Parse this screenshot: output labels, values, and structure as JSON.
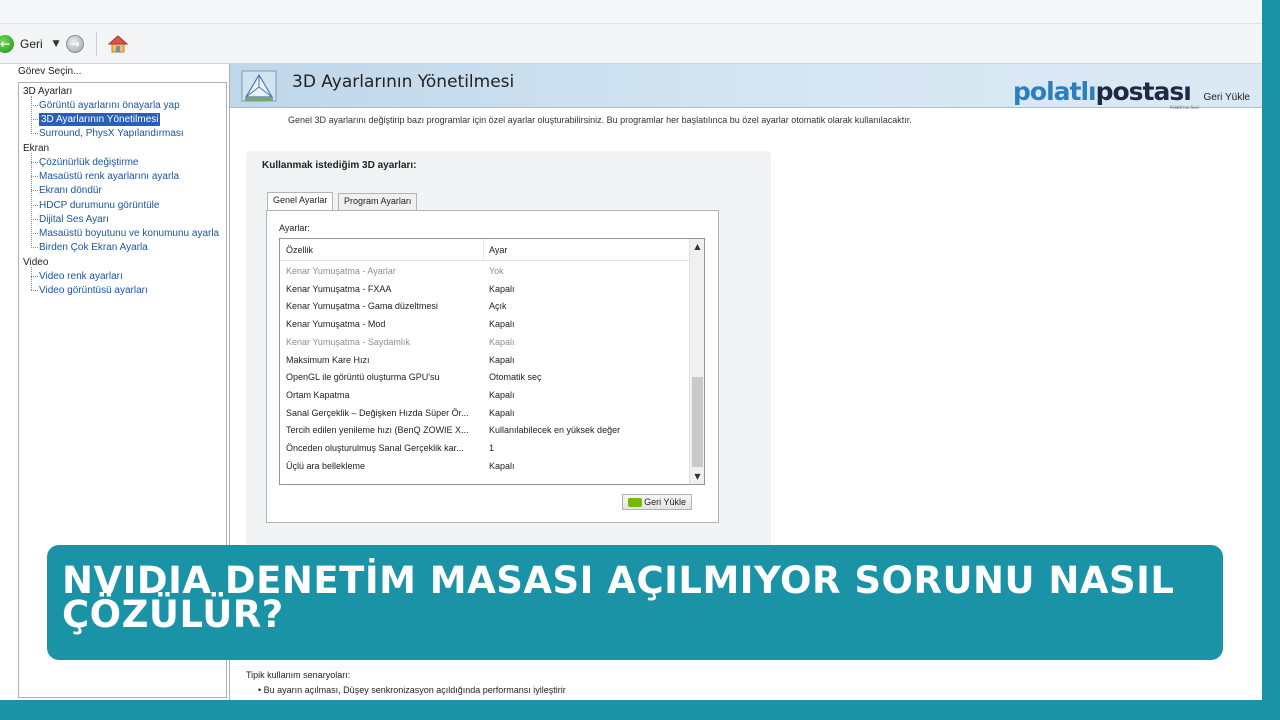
{
  "toolbar": {
    "back_label": "Geri",
    "back_icon": "back-arrow-icon",
    "forward_icon": "forward-arrow-icon",
    "home_icon": "home-icon"
  },
  "sidebar": {
    "header": "Görev Seçin...",
    "items": [
      {
        "type": "category",
        "label": "3D Ayarları"
      },
      {
        "type": "leaf",
        "label": "Görüntü ayarlarını önayarla yap"
      },
      {
        "type": "leaf",
        "label": "3D Ayarlarının Yönetilmesi",
        "selected": true
      },
      {
        "type": "leaf",
        "label": "Surround, PhysX Yapılandırması"
      },
      {
        "type": "category",
        "label": "Ekran"
      },
      {
        "type": "leaf",
        "label": "Çözünürlük değiştirme"
      },
      {
        "type": "leaf",
        "label": "Masaüstü renk ayarlarını ayarla"
      },
      {
        "type": "leaf",
        "label": "Ekranı döndür"
      },
      {
        "type": "leaf",
        "label": "HDCP durumunu görüntüle"
      },
      {
        "type": "leaf",
        "label": "Dijital Ses Ayarı"
      },
      {
        "type": "leaf",
        "label": "Masaüstü boyutunu ve konumunu ayarla"
      },
      {
        "type": "leaf",
        "label": "Birden Çok Ekran Ayarla"
      },
      {
        "type": "category",
        "label": "Video"
      },
      {
        "type": "leaf",
        "label": "Video renk ayarları"
      },
      {
        "type": "leaf",
        "label": "Video görüntüsü ayarları"
      }
    ]
  },
  "main": {
    "title": "3D Ayarlarının Yönetilmesi",
    "restore_link": "Geri Yükle",
    "description": "Genel 3D ayarlarını değiştirip bazı programlar için özel ayarlar oluşturabilirsiniz. Bu programlar her başlatılınca bu özel ayarlar otomatik olarak kullanılacaktır.",
    "group_label": "Kullanmak istediğim 3D ayarları:",
    "tabs": [
      "Genel Ayarlar",
      "Program Ayarları"
    ],
    "settings_label": "Ayarlar:",
    "columns": [
      "Özellik",
      "Ayar"
    ],
    "rows": [
      {
        "feature": "Kenar Yumuşatma - Ayarlar",
        "value": "Yok",
        "disabled": true
      },
      {
        "feature": "Kenar Yumuşatma - FXAA",
        "value": "Kapalı",
        "disabled": false
      },
      {
        "feature": "Kenar Yumuşatma - Gama düzeltmesi",
        "value": "Açık",
        "disabled": false
      },
      {
        "feature": "Kenar Yumuşatma - Mod",
        "value": "Kapalı",
        "disabled": false
      },
      {
        "feature": "Kenar Yumuşatma - Saydamlık",
        "value": "Kapalı",
        "disabled": true
      },
      {
        "feature": "Maksimum Kare Hızı",
        "value": "Kapalı",
        "disabled": false
      },
      {
        "feature": "OpenGL ile görüntü oluşturma GPU'su",
        "value": "Otomatik seç",
        "disabled": false
      },
      {
        "feature": "Ortam Kapatma",
        "value": "Kapalı",
        "disabled": false
      },
      {
        "feature": "Sanal Gerçeklik – Değişken Hızda Süper Ör...",
        "value": "Kapalı",
        "disabled": false
      },
      {
        "feature": "Tercih edilen yenileme hızı (BenQ ZOWIE X...",
        "value": "Kullanılabilecek en yüksek değer",
        "disabled": false
      },
      {
        "feature": "Önceden oluşturulmuş Sanal Gerçeklik kar...",
        "value": "1",
        "disabled": false
      },
      {
        "feature": "Üçlü ara bellekleme",
        "value": "Kapalı",
        "disabled": false
      }
    ],
    "restore_button": "Geri Yükle",
    "usage_heading": "Tipik kullanım senaryoları:",
    "usage_item": "• Bu ayarın açılması, Düşey senkronizasyon açıldığında performansı iyileştirir"
  },
  "logo": {
    "part1": "polatlı",
    "part2": "postası",
    "sub": "Polatlı'nın Sesi"
  },
  "headline": "NVIDIA DENETİM MASASI AÇILMIYOR SORUNU NASIL ÇÖZÜLÜR?",
  "colors": {
    "background": "#1b93a7",
    "selected": "#2a5fb8",
    "link": "#1a55a8",
    "nvidia_green": "#76b900"
  }
}
